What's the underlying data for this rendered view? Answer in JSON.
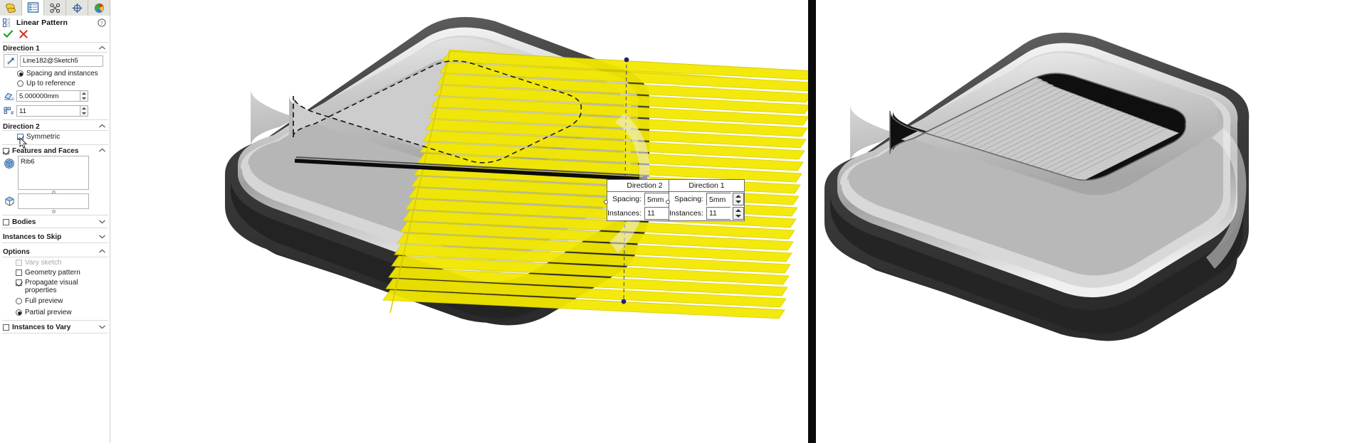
{
  "panel": {
    "tabs": [
      {
        "name": "feature-manager-tab",
        "icon": "feature-tree-icon",
        "active": false
      },
      {
        "name": "property-manager-tab",
        "icon": "property-list-icon",
        "active": true
      },
      {
        "name": "configuration-manager-tab",
        "icon": "configurations-icon",
        "active": false
      },
      {
        "name": "dimxpert-manager-tab",
        "icon": "dimxpert-icon",
        "active": false
      },
      {
        "name": "display-manager-tab",
        "icon": "display-palette-icon",
        "active": false
      }
    ],
    "title": "Linear Pattern",
    "help_icon": "question-mark-icon",
    "accept_icon": "green-check-icon",
    "cancel_icon": "red-x-icon",
    "direction1": {
      "header": "Direction 1",
      "reference_value": "Line182@Sketch5",
      "reference_icon": "direction-arrow-icon",
      "mode_spacing_label": "Spacing and instances",
      "mode_spacing_selected": true,
      "mode_uptoref_label": "Up to reference",
      "mode_uptoref_selected": false,
      "spacing_icon": "spacing-dimension-icon",
      "spacing_value": "5.000000mm",
      "instances_icon": "instance-count-icon",
      "instances_value": "11"
    },
    "direction2": {
      "header": "Direction 2",
      "symmetric_label": "Symmetric",
      "symmetric_checked": true
    },
    "features_and_faces": {
      "header": "Features and Faces",
      "header_checked": true,
      "features_icon": "feature-solid-icon",
      "features_value": "Rib6",
      "faces_icon": "face-cube-icon",
      "faces_value": ""
    },
    "bodies": {
      "label": "Bodies",
      "checked": false
    },
    "instances_to_skip": {
      "header": "Instances to Skip"
    },
    "options": {
      "header": "Options",
      "vary_sketch": {
        "label": "Vary sketch",
        "checked": false,
        "disabled": true
      },
      "geometry_pattern": {
        "label": "Geometry pattern",
        "checked": false,
        "disabled": false
      },
      "propagate_visual": {
        "label": "Propagate visual properties",
        "checked": true,
        "disabled": false
      },
      "full_preview": {
        "label": "Full preview",
        "selected": false
      },
      "partial_preview": {
        "label": "Partial preview",
        "selected": true
      }
    },
    "instances_to_vary": {
      "label": "Instances to Vary",
      "checked": false
    }
  },
  "viewport": {
    "left_model_name": "vent-grille-preview-model",
    "right_model_name": "vent-grille-result-model",
    "callouts": [
      {
        "name": "direction-2-callout",
        "title": "Direction 2",
        "spacing_label": "Spacing:",
        "spacing_value": "5mm",
        "instances_label": "Instances:",
        "instances_value": "11"
      },
      {
        "name": "direction-1-callout",
        "title": "Direction 1",
        "spacing_label": "Spacing:",
        "spacing_value": "5mm",
        "instances_label": "Instances:",
        "instances_value": "11"
      }
    ]
  },
  "colors": {
    "preview_yellow": "#f2e80a",
    "panel_bg": "#ffffff",
    "divider": "#0b0b0b",
    "accept_green": "#19a319",
    "cancel_red": "#d6362c"
  }
}
